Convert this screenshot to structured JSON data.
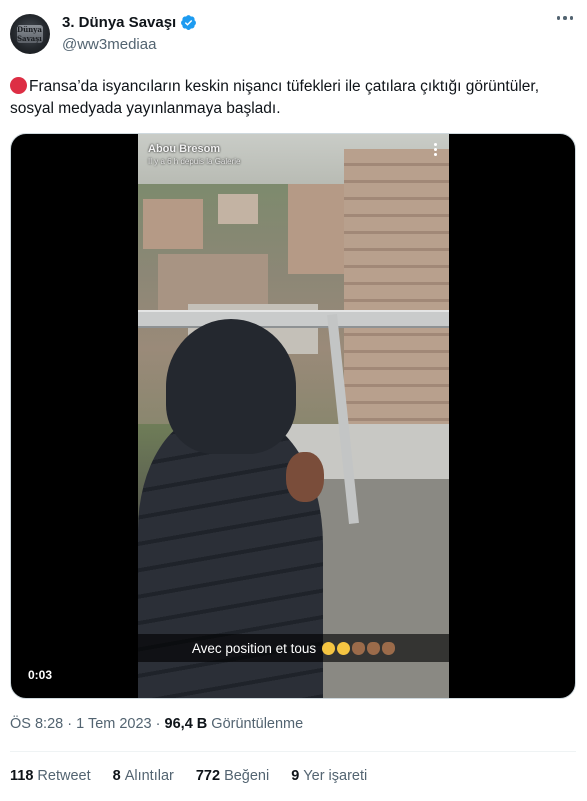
{
  "author": {
    "display_name": "3. Dünya Savaşı",
    "handle": "@ww3mediaa",
    "verified": true,
    "avatar_icon": "avatar-logo-icon",
    "avatar_text": "Dünya Savaşı"
  },
  "tweet": {
    "text": "Fransa’da isyancıların keskin nişancı tüfekleri ile çatılara çıktığı görüntüler, sosyal medyada yayınlanmaya başladı.",
    "leading_emoji": "red-circle-icon"
  },
  "video": {
    "overlay_username": "Abou Bresom",
    "overlay_subtitle": "Il y a 6 h depuis la Galerie",
    "caption": "Avec position et tous",
    "caption_emojis": [
      "laugh-icon",
      "laugh-icon",
      "ok-hand-icon",
      "ok-hand-icon",
      "ok-hand-icon"
    ],
    "duration": "0:03"
  },
  "meta": {
    "time": "ÖS 8:28",
    "separator": "·",
    "date": "1 Tem 2023",
    "views_count": "96,4 B",
    "views_label": "Görüntülenme"
  },
  "stats": [
    {
      "count": "118",
      "label": "Retweet"
    },
    {
      "count": "8",
      "label": "Alıntılar"
    },
    {
      "count": "772",
      "label": "Beğeni"
    },
    {
      "count": "9",
      "label": "Yer işareti"
    }
  ],
  "colors": {
    "verified_blue": "#1d9bf0",
    "text_primary": "#0f1419",
    "text_secondary": "#536471",
    "red_circle": "#dd2e44"
  }
}
